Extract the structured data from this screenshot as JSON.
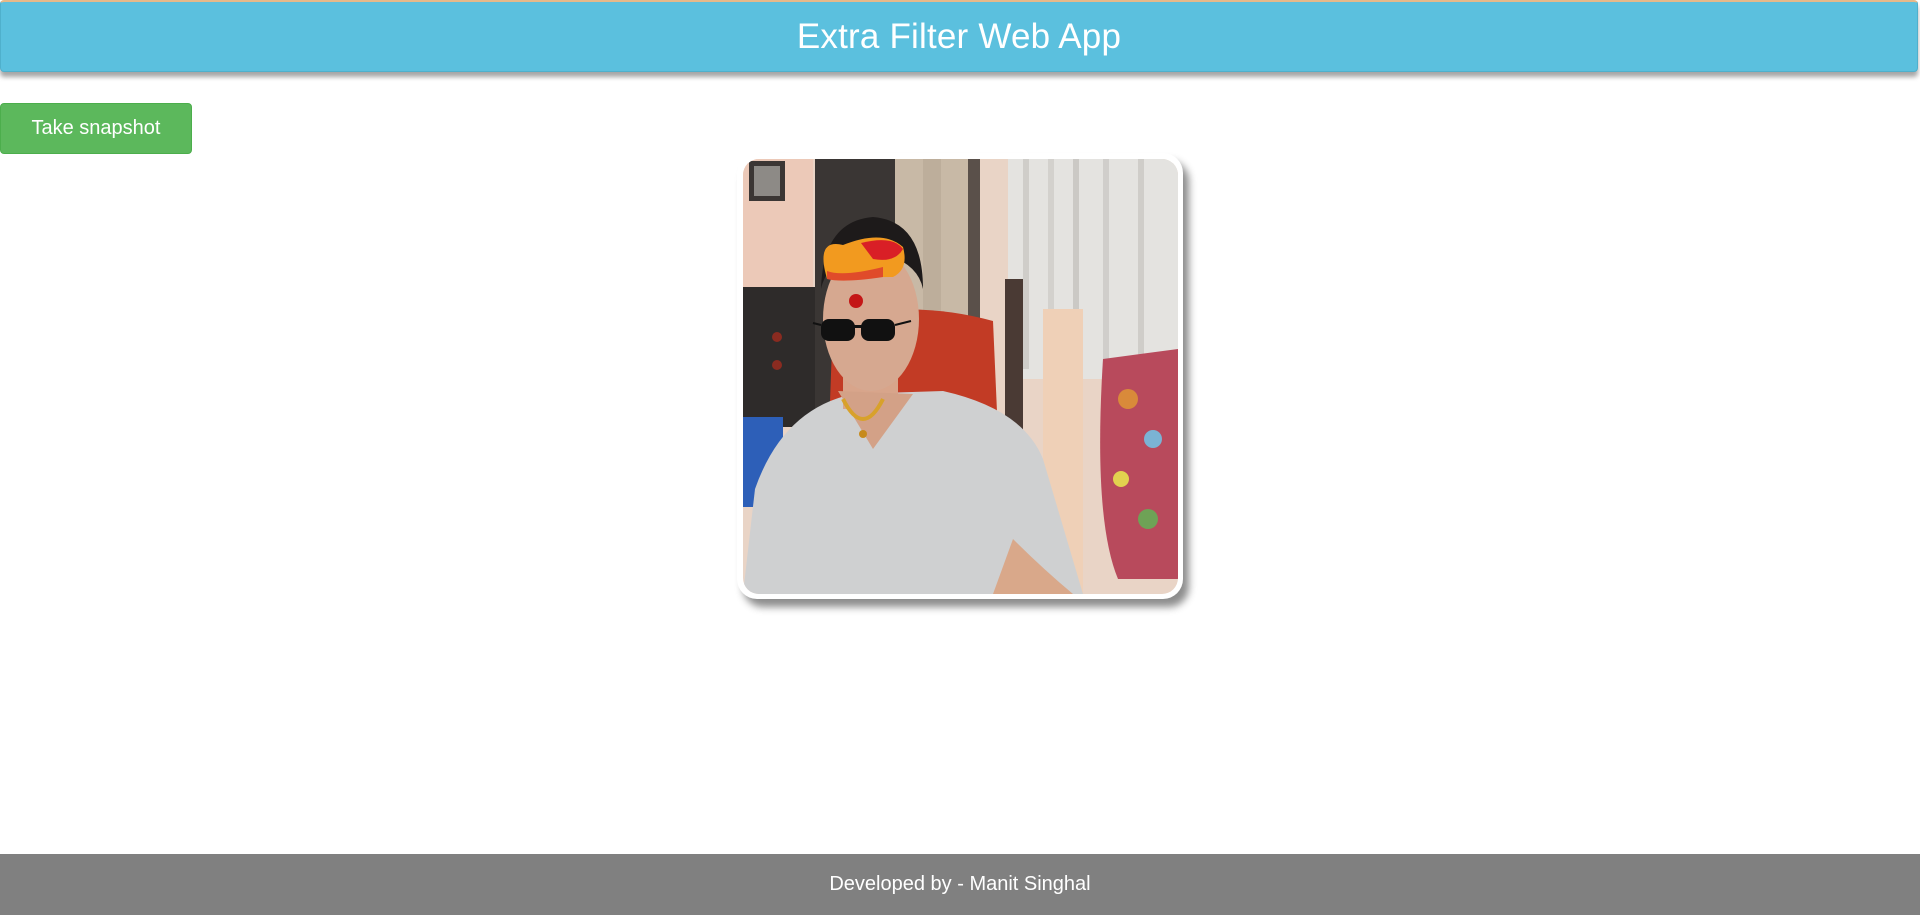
{
  "header": {
    "title": "Extra Filter Web App",
    "background_color": "#5bc0de"
  },
  "actions": {
    "snapshot_label": "Take snapshot",
    "snapshot_color": "#5cb85c"
  },
  "video": {
    "filters": [
      "turban-overlay",
      "bindi-overlay",
      "sunglasses-overlay",
      "necklace-overlay"
    ]
  },
  "footer": {
    "credit": "Developed by - Manit Singhal",
    "background_color": "#808080"
  }
}
